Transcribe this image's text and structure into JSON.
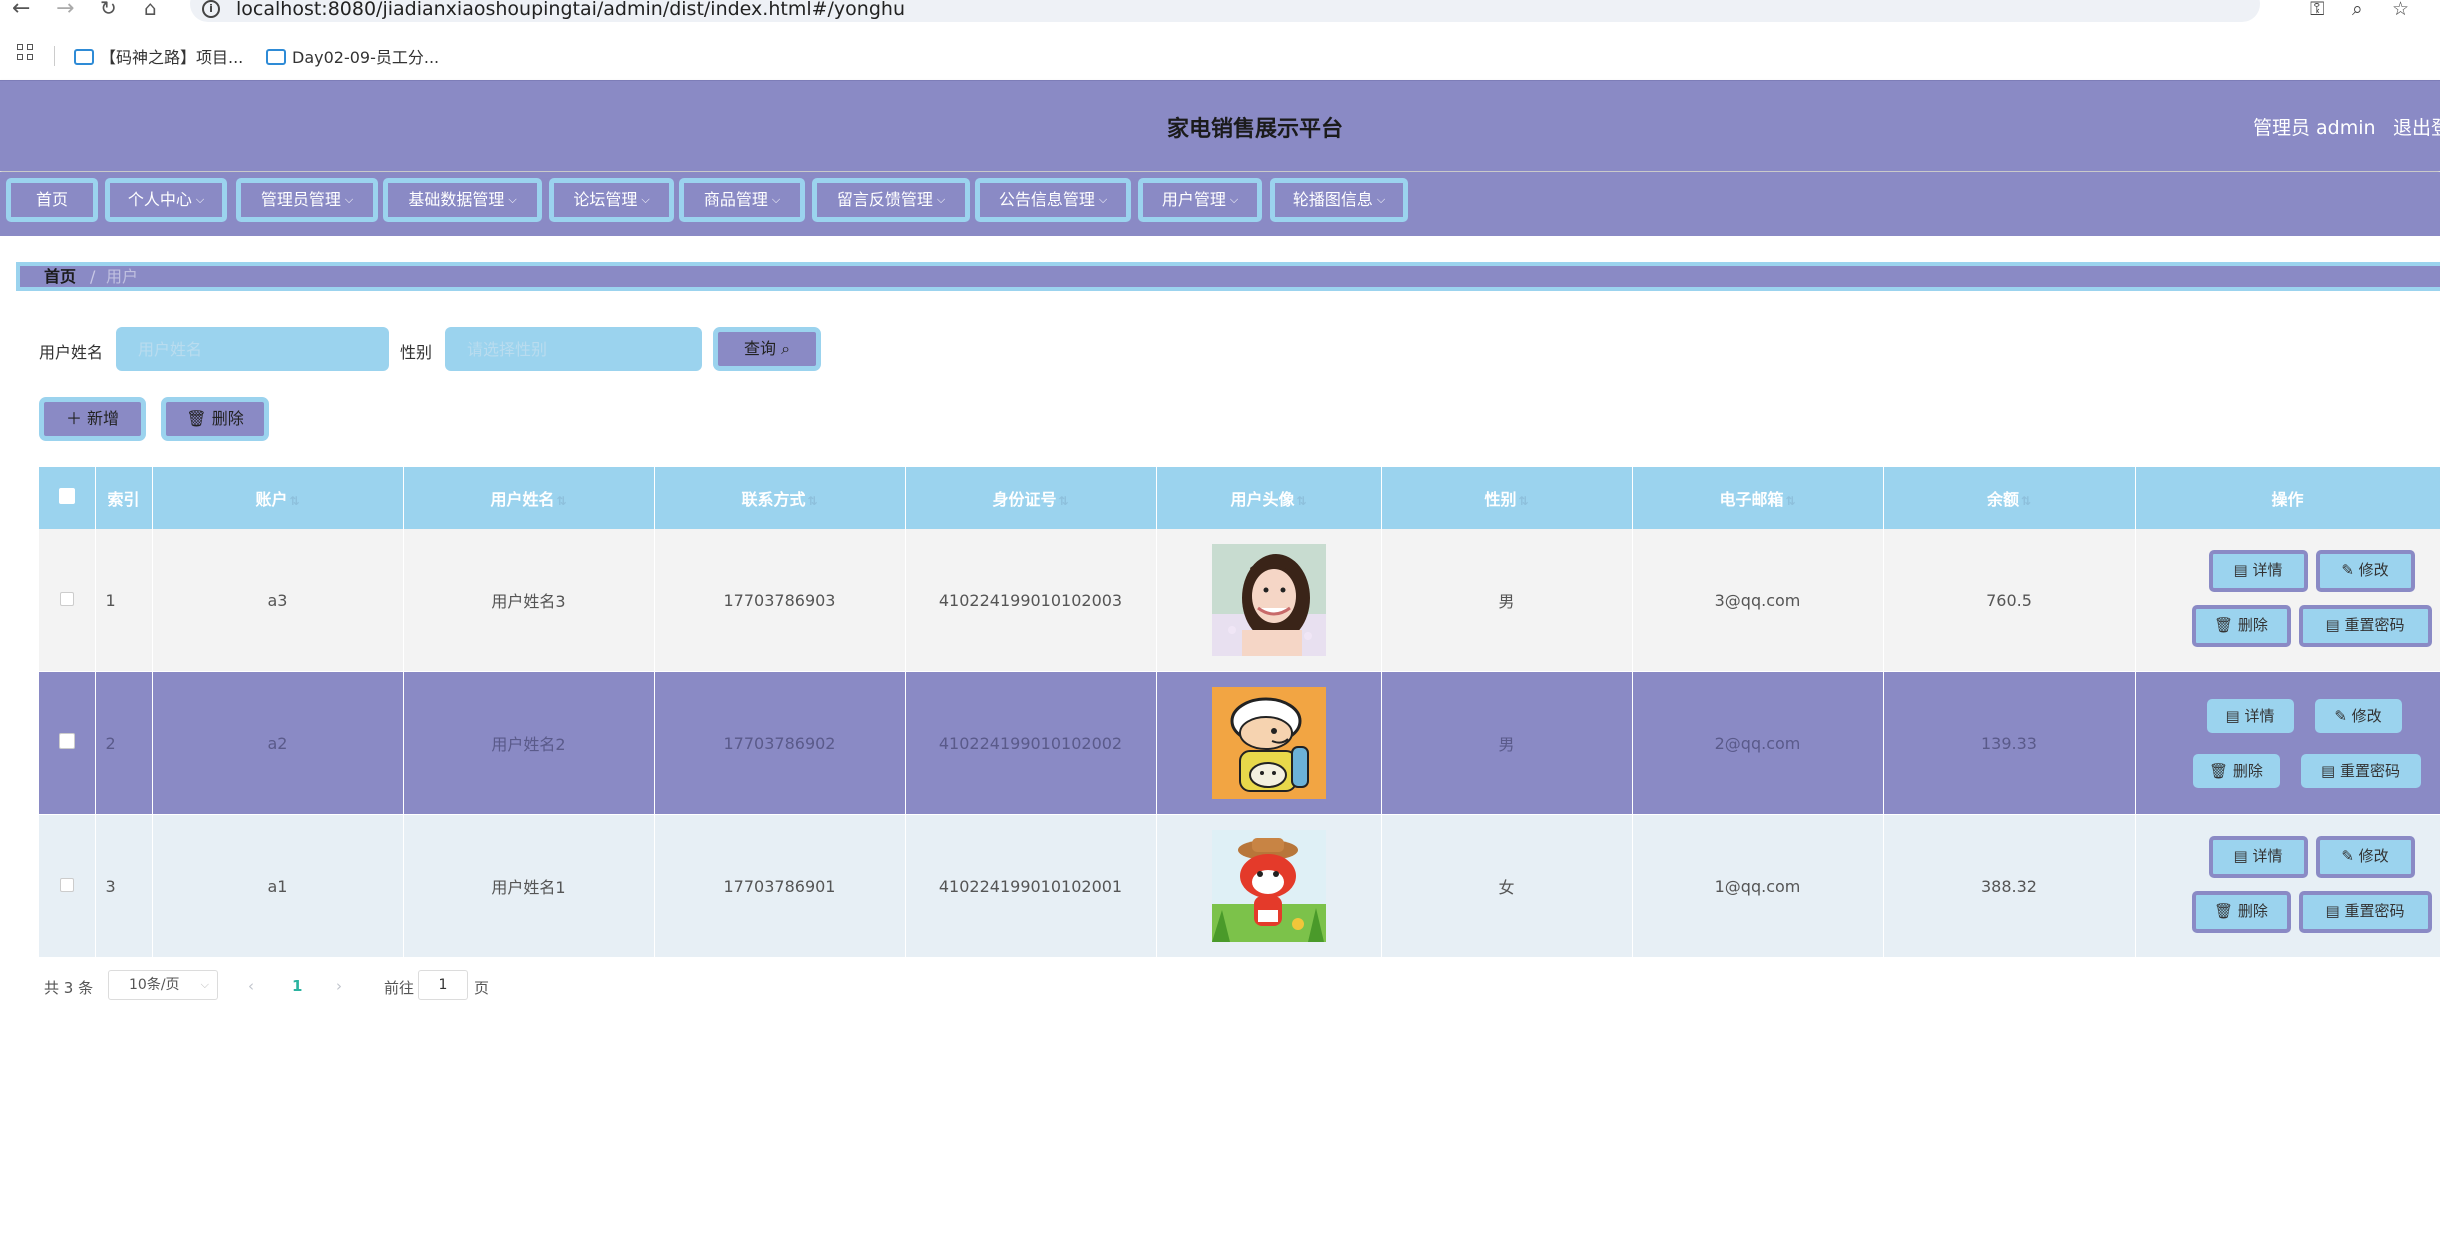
{
  "browser": {
    "url": "localhost:8080/jiadianxiaoshoupingtai/admin/dist/index.html#/yonghu",
    "bookmarks": [
      "【码神之路】项目...",
      "Day02-09-员工分..."
    ]
  },
  "header": {
    "title": "家电销售展示平台",
    "admin_label": "管理员 admin",
    "logout": "退出登"
  },
  "nav": [
    "首页",
    "个人中心",
    "管理员管理",
    "基础数据管理",
    "论坛管理",
    "商品管理",
    "留言反馈管理",
    "公告信息管理",
    "用户管理",
    "轮播图信息"
  ],
  "breadcrumb": {
    "home": "首页",
    "sep": "/",
    "current": "用户"
  },
  "search": {
    "name_label": "用户姓名",
    "name_placeholder": "用户姓名",
    "gender_label": "性别",
    "gender_placeholder": "请选择性别",
    "query_button": "查询"
  },
  "actions": {
    "add": "新增",
    "delete": "删除"
  },
  "table": {
    "headers": [
      "索引",
      "账户",
      "用户姓名",
      "联系方式",
      "身份证号",
      "用户头像",
      "性别",
      "电子邮箱",
      "余额",
      "操作"
    ],
    "rows": [
      {
        "index": "1",
        "account": "a3",
        "name": "用户姓名3",
        "phone": "17703786903",
        "id_number": "410224199010102003",
        "avatar": "girl-photo",
        "gender": "男",
        "email": "3@qq.com",
        "balance": "760.5"
      },
      {
        "index": "2",
        "account": "a2",
        "name": "用户姓名2",
        "phone": "17703786902",
        "id_number": "410224199010102002",
        "avatar": "cartoon-boy",
        "gender": "男",
        "email": "2@qq.com",
        "balance": "139.33"
      },
      {
        "index": "3",
        "account": "a1",
        "name": "用户姓名1",
        "phone": "17703786901",
        "id_number": "410224199010102001",
        "avatar": "cartoon-fox",
        "gender": "女",
        "email": "1@qq.com",
        "balance": "388.32"
      }
    ],
    "row_actions": {
      "detail": "详情",
      "edit": "修改",
      "delete": "删除",
      "reset": "重置密码"
    }
  },
  "pagination": {
    "total": "共 3 条",
    "page_size": "10条/页",
    "current_page": "1",
    "goto_label": "前往",
    "goto_value": "1",
    "page_suffix": "页"
  },
  "colors": {
    "primary": "#8a8ac5",
    "accent": "#9bd3ee",
    "active_page": "#2bb3a0"
  }
}
